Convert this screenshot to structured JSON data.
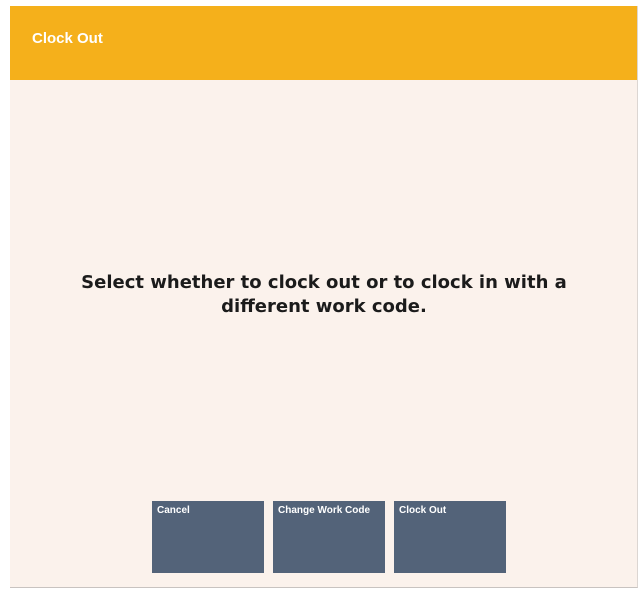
{
  "dialog": {
    "title": "Clock Out",
    "message": "Select whether to clock out or to clock in with a different work code."
  },
  "buttons": {
    "cancel_label": "Cancel",
    "change_work_code_label": "Change Work Code",
    "clock_out_label": "Clock Out"
  },
  "colors": {
    "title_bar": "#f5b01b",
    "background": "#fbf2ec",
    "button": "#536379",
    "button_text": "#ffffff",
    "message_text": "#1b1b1b"
  }
}
